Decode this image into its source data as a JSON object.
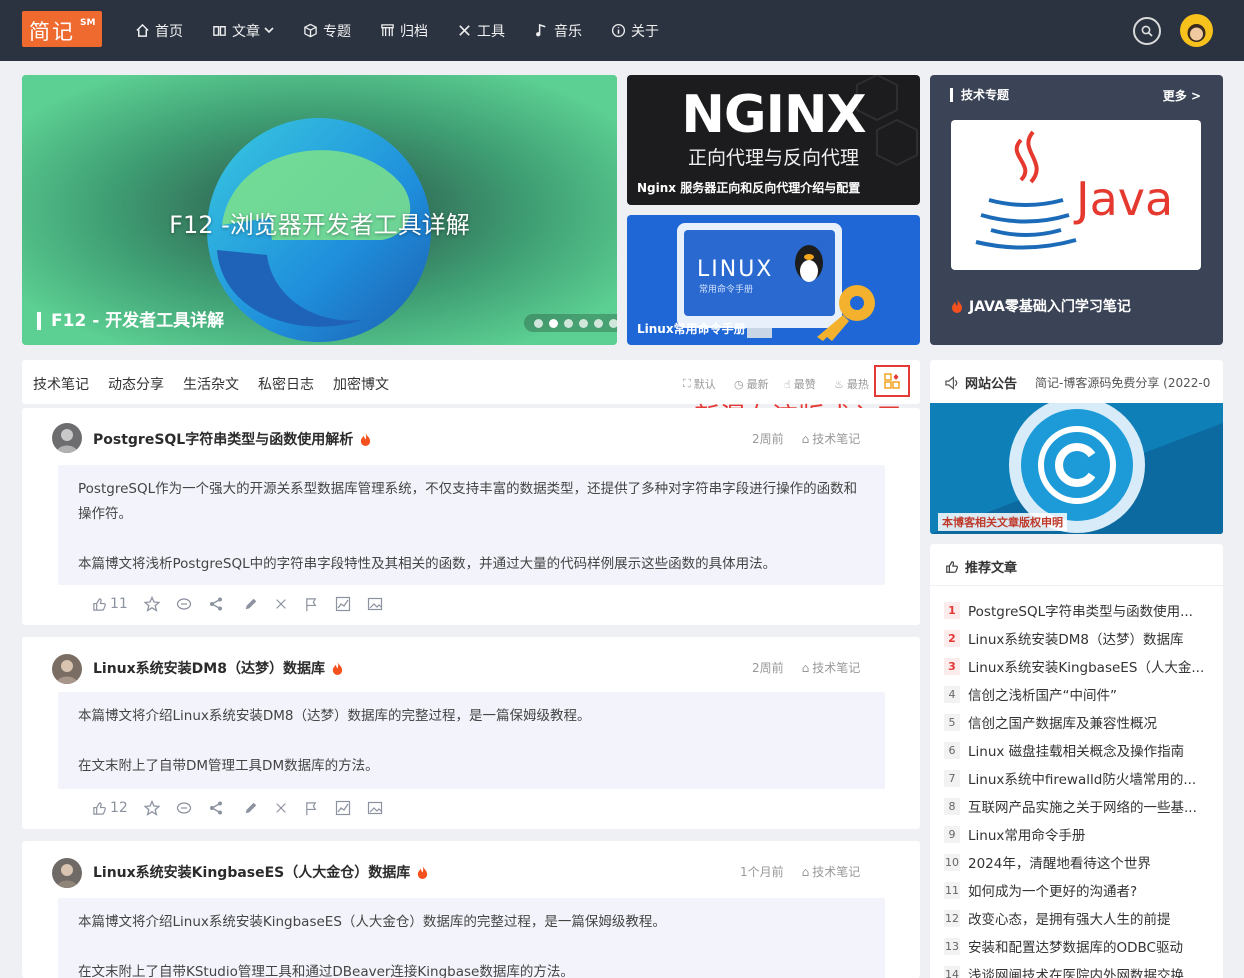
{
  "header": {
    "logo": {
      "main": "简记",
      "sup": "SM"
    },
    "nav": [
      {
        "label": "首页",
        "icon": "home-icon"
      },
      {
        "label": "文章",
        "icon": "book-icon",
        "has_dropdown": true
      },
      {
        "label": "专题",
        "icon": "cube-icon"
      },
      {
        "label": "归档",
        "icon": "archive-icon"
      },
      {
        "label": "工具",
        "icon": "tools-icon"
      },
      {
        "label": "音乐",
        "icon": "music-icon"
      },
      {
        "label": "关于",
        "icon": "info-icon"
      }
    ]
  },
  "hero": {
    "slide_title": "F12 -浏览器开发者工具详解",
    "caption": "F12 - 开发者工具详解",
    "slides_count": 6,
    "active_slide": 2
  },
  "cards": {
    "nginx": {
      "logo": "NGINX",
      "subtitle": "正向代理与反向代理",
      "caption": "Nginx 服务器正向和反向代理介绍与配置"
    },
    "linux": {
      "logo": "LINUX",
      "subtitle": "常用命令手册",
      "caption": "Linux常用命令手册"
    }
  },
  "topic": {
    "heading": "技术专题",
    "more": "更多 >",
    "logo_text": "Java",
    "caption": "JAVA零基础入门学习笔记"
  },
  "tabs": {
    "categories": [
      "技术笔记",
      "动态分享",
      "生活杂文",
      "私密日志",
      "加密博文"
    ],
    "sorts": [
      {
        "label": "默认",
        "icon": "sort-default-icon"
      },
      {
        "label": "最新",
        "icon": "clock-icon"
      },
      {
        "label": "最赞",
        "icon": "thumb-icon"
      },
      {
        "label": "最热",
        "icon": "fire-icon"
      }
    ],
    "annotation": "新瀑布流版式入口"
  },
  "posts": [
    {
      "title": "PostgreSQL字符串类型与函数使用解析",
      "time": "2周前",
      "category": "技术笔记",
      "paragraphs": [
        "PostgreSQL作为一个强大的开源关系型数据库管理系统，不仅支持丰富的数据类型，还提供了多种对字符串字段进行操作的函数和操作符。",
        "本篇博文将浅析PostgreSQL中的字符串字段特性及其相关的函数，并通过大量的代码样例展示这些函数的具体用法。"
      ],
      "likes": "11"
    },
    {
      "title": "Linux系统安装DM8（达梦）数据库",
      "time": "2周前",
      "category": "技术笔记",
      "paragraphs": [
        "本篇博文将介绍Linux系统安装DM8（达梦）数据库的完整过程，是一篇保姆级教程。",
        "在文末附上了自带DM管理工具DM数据库的方法。"
      ],
      "likes": "12"
    },
    {
      "title": "Linux系统安装KingbaseES（人大金仓）数据库",
      "time": "1个月前",
      "category": "技术笔记",
      "paragraphs": [
        "本篇博文将介绍Linux系统安装KingbaseES（人大金仓）数据库的完整过程，是一篇保姆级教程。",
        "在文末附上了自带KStudio管理工具和通过DBeaver连接Kingbase数据库的方法。"
      ],
      "likes": ""
    }
  ],
  "notice": {
    "heading": "网站公告",
    "scroll_text": "简记-博客源码免费分享 (2022-0",
    "banner_caption": "本博客相关文章版权申明"
  },
  "recommended": {
    "heading": "推荐文章",
    "items": [
      {
        "num": "1",
        "title": "PostgreSQL字符串类型与函数使用..."
      },
      {
        "num": "2",
        "title": "Linux系统安装DM8（达梦）数据库"
      },
      {
        "num": "3",
        "title": "Linux系统安装KingbaseES（人大金..."
      },
      {
        "num": "4",
        "title": "信创之浅析国产“中间件”"
      },
      {
        "num": "5",
        "title": "信创之国产数据库及兼容性概况"
      },
      {
        "num": "6",
        "title": "Linux 磁盘挂载相关概念及操作指南"
      },
      {
        "num": "7",
        "title": "Linux系统中firewalld防火墙常用的..."
      },
      {
        "num": "8",
        "title": "互联网产品实施之关于网络的一些基..."
      },
      {
        "num": "9",
        "title": "Linux常用命令手册"
      },
      {
        "num": "10",
        "title": "2024年，清醒地看待这个世界"
      },
      {
        "num": "11",
        "title": "如何成为一个更好的沟通者?"
      },
      {
        "num": "12",
        "title": "改变心态，是拥有强大人生的前提"
      },
      {
        "num": "13",
        "title": "安装和配置达梦数据库的ODBC驱动"
      },
      {
        "num": "14",
        "title": "浅谈网闸技术在医院内外网数据交换"
      }
    ]
  },
  "colors": {
    "header_bg": "#2b3240",
    "logo_bg": "#ef6a2e",
    "accent_red": "#e53935",
    "fire": "#f4511e"
  }
}
